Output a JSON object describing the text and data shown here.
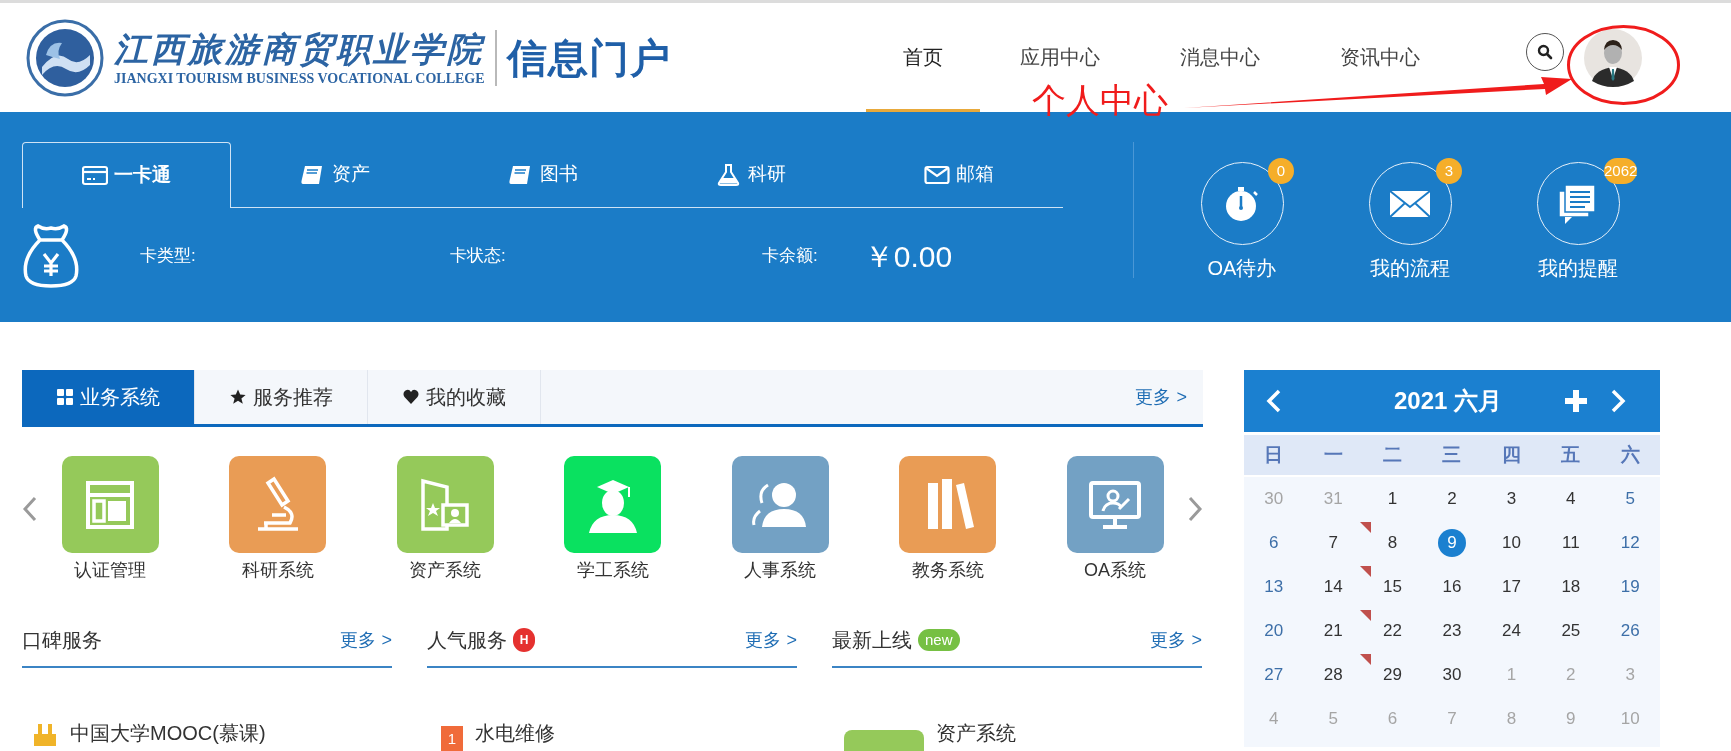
{
  "header": {
    "school_name": "江西旅游商贸职业学院",
    "school_name_en": "JIANGXI TOURISM BUSINESS VOCATIONAL COLLEGE",
    "portal_name": "信息门户",
    "nav": [
      {
        "label": "首页",
        "selected": true
      },
      {
        "label": "应用中心",
        "selected": false
      },
      {
        "label": "消息中心",
        "selected": false
      },
      {
        "label": "资讯中心",
        "selected": false
      }
    ],
    "annotation": "个人中心"
  },
  "card_panel": {
    "tabs": [
      {
        "label": "一卡通",
        "selected": true
      },
      {
        "label": "资产",
        "selected": false
      },
      {
        "label": "图书",
        "selected": false
      },
      {
        "label": "科研",
        "selected": false
      },
      {
        "label": "邮箱",
        "selected": false
      }
    ],
    "fields": [
      {
        "label": "卡类型:"
      },
      {
        "label": "卡状态:"
      },
      {
        "label": "卡余额:",
        "value": "￥0.00"
      }
    ]
  },
  "shortcuts": [
    {
      "label": "OA待办",
      "badge": "0"
    },
    {
      "label": "我的流程",
      "badge": "3"
    },
    {
      "label": "我的提醒",
      "badge": "2062"
    }
  ],
  "system_tabs": [
    {
      "label": "业务系统",
      "selected": true
    },
    {
      "label": "服务推荐",
      "selected": false
    },
    {
      "label": "我的收藏",
      "selected": false
    }
  ],
  "system_more": "更多 >",
  "systems": [
    {
      "label": "认证管理",
      "color": "#95c95a"
    },
    {
      "label": "科研系统",
      "color": "#e99c55"
    },
    {
      "label": "资产系统",
      "color": "#95c95a"
    },
    {
      "label": "学工系统",
      "color": "#0ae160"
    },
    {
      "label": "人事系统",
      "color": "#73a1c4"
    },
    {
      "label": "教务系统",
      "color": "#e99c55"
    },
    {
      "label": "OA系统",
      "color": "#73a1c4"
    }
  ],
  "service_columns": [
    {
      "title": "口碑服务",
      "more": "更多 >",
      "items": [
        {
          "title": "中国大学MOOC(慕课)"
        }
      ]
    },
    {
      "title": "人气服务",
      "tag": "H",
      "more": "更多 >",
      "items": [
        {
          "rank": "1",
          "title": "水电维修"
        }
      ]
    },
    {
      "title": "最新上线",
      "tag": "new",
      "more": "更多 >",
      "items": [
        {
          "title": "资产系统"
        }
      ]
    }
  ],
  "calendar": {
    "title": "2021 六月",
    "weekdays": [
      "日",
      "一",
      "二",
      "三",
      "四",
      "五",
      "六"
    ],
    "weeks": [
      [
        {
          "day": "30",
          "muted": true,
          "marked": false,
          "selected": false
        },
        {
          "day": "31",
          "muted": true,
          "marked": false,
          "selected": false
        },
        {
          "day": "1",
          "muted": false,
          "marked": false,
          "selected": false
        },
        {
          "day": "2",
          "muted": false,
          "marked": false,
          "selected": false
        },
        {
          "day": "3",
          "muted": false,
          "marked": false,
          "selected": false
        },
        {
          "day": "4",
          "muted": false,
          "marked": false,
          "selected": false
        },
        {
          "day": "5",
          "muted": false,
          "marked": false,
          "selected": false
        }
      ],
      [
        {
          "day": "6",
          "muted": false,
          "marked": false,
          "selected": false
        },
        {
          "day": "7",
          "muted": false,
          "marked": true,
          "selected": false
        },
        {
          "day": "8",
          "muted": false,
          "marked": false,
          "selected": false
        },
        {
          "day": "9",
          "muted": false,
          "marked": false,
          "selected": true
        },
        {
          "day": "10",
          "muted": false,
          "marked": false,
          "selected": false
        },
        {
          "day": "11",
          "muted": false,
          "marked": false,
          "selected": false
        },
        {
          "day": "12",
          "muted": false,
          "marked": false,
          "selected": false
        }
      ],
      [
        {
          "day": "13",
          "muted": false,
          "marked": false,
          "selected": false
        },
        {
          "day": "14",
          "muted": false,
          "marked": true,
          "selected": false
        },
        {
          "day": "15",
          "muted": false,
          "marked": false,
          "selected": false
        },
        {
          "day": "16",
          "muted": false,
          "marked": false,
          "selected": false
        },
        {
          "day": "17",
          "muted": false,
          "marked": false,
          "selected": false
        },
        {
          "day": "18",
          "muted": false,
          "marked": false,
          "selected": false
        },
        {
          "day": "19",
          "muted": false,
          "marked": false,
          "selected": false
        }
      ],
      [
        {
          "day": "20",
          "muted": false,
          "marked": false,
          "selected": false
        },
        {
          "day": "21",
          "muted": false,
          "marked": true,
          "selected": false
        },
        {
          "day": "22",
          "muted": false,
          "marked": false,
          "selected": false
        },
        {
          "day": "23",
          "muted": false,
          "marked": false,
          "selected": false
        },
        {
          "day": "24",
          "muted": false,
          "marked": false,
          "selected": false
        },
        {
          "day": "25",
          "muted": false,
          "marked": false,
          "selected": false
        },
        {
          "day": "26",
          "muted": false,
          "marked": false,
          "selected": false
        }
      ],
      [
        {
          "day": "27",
          "muted": false,
          "marked": false,
          "selected": false
        },
        {
          "day": "28",
          "muted": false,
          "marked": true,
          "selected": false
        },
        {
          "day": "29",
          "muted": false,
          "marked": false,
          "selected": false
        },
        {
          "day": "30",
          "muted": false,
          "marked": false,
          "selected": false
        },
        {
          "day": "1",
          "muted": true,
          "marked": false,
          "selected": false
        },
        {
          "day": "2",
          "muted": true,
          "marked": false,
          "selected": false
        },
        {
          "day": "3",
          "muted": true,
          "marked": false,
          "selected": false
        }
      ],
      [
        {
          "day": "4",
          "muted": true,
          "marked": false,
          "selected": false
        },
        {
          "day": "5",
          "muted": true,
          "marked": false,
          "selected": false
        },
        {
          "day": "6",
          "muted": true,
          "marked": false,
          "selected": false
        },
        {
          "day": "7",
          "muted": true,
          "marked": false,
          "selected": false
        },
        {
          "day": "8",
          "muted": true,
          "marked": false,
          "selected": false
        },
        {
          "day": "9",
          "muted": true,
          "marked": false,
          "selected": false
        },
        {
          "day": "10",
          "muted": true,
          "marked": false,
          "selected": false
        }
      ]
    ]
  }
}
